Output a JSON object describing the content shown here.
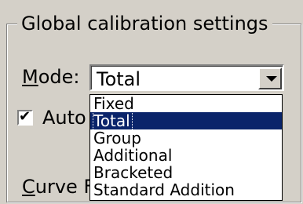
{
  "group": {
    "title": "Global calibration settings"
  },
  "mode": {
    "label": "Mode:",
    "value": "Total",
    "options": [
      "Fixed",
      "Total",
      "Group",
      "Additional",
      "Bracketed",
      "Standard Addition"
    ],
    "selected_index": 1
  },
  "auto_checkbox": {
    "label": "Auto",
    "checked": true
  },
  "curve_fit": {
    "label": "Curve Fit"
  },
  "icons": {
    "dropdown_arrow": "chevron-down-icon",
    "checkmark": "checkmark-icon"
  }
}
